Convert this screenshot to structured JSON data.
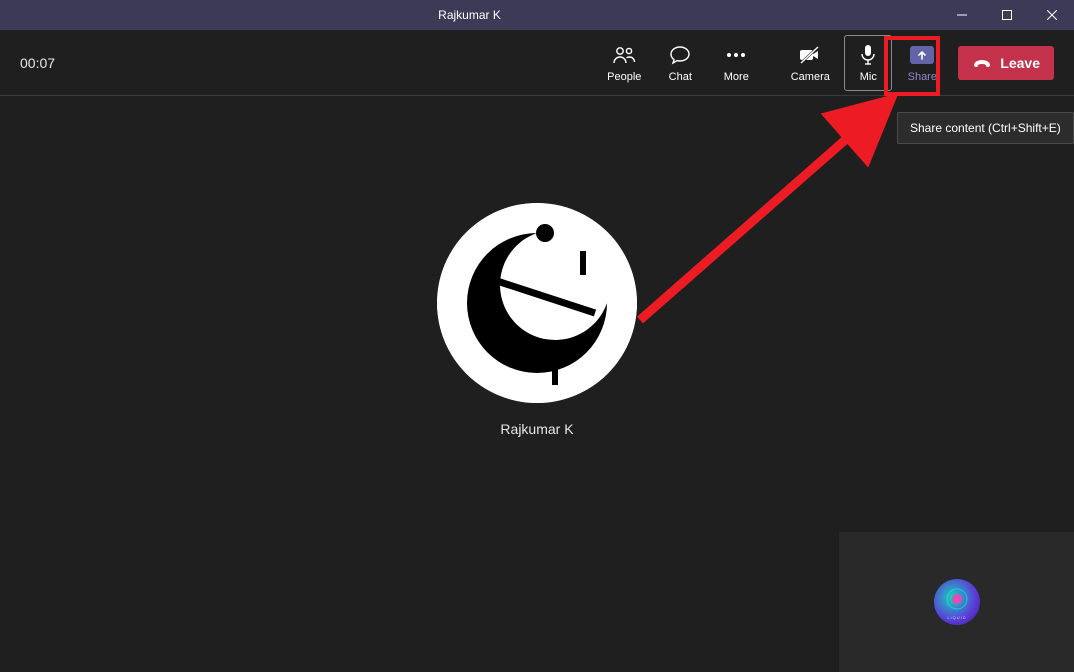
{
  "window": {
    "title": "Rajkumar K"
  },
  "call": {
    "timer": "00:07"
  },
  "toolbar": {
    "people": "People",
    "chat": "Chat",
    "more": "More",
    "camera": "Camera",
    "mic": "Mic",
    "share": "Share",
    "leave": "Leave"
  },
  "tooltip": {
    "share": "Share content (Ctrl+Shift+E)"
  },
  "participant": {
    "name": "Rajkumar K"
  },
  "self": {
    "label": "LIQUID"
  },
  "annotation": {
    "highlight_color": "#ed1c24"
  }
}
